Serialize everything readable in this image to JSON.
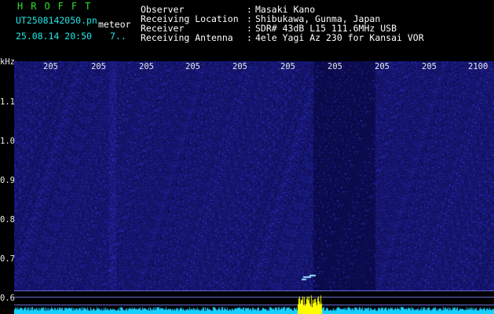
{
  "header": {
    "app_title": "HROFFT",
    "filename": "UT2508142050.pn",
    "mode": "meteor",
    "datetime": "25.08.14 20:50",
    "counter": "7..",
    "fields": [
      {
        "label": "Observer",
        "sep": ":",
        "value": "Masaki Kano"
      },
      {
        "label": "Receiving Location",
        "sep": ":",
        "value": "Shibukawa, Gunma, Japan"
      },
      {
        "label": "Receiver",
        "sep": ":",
        "value": "SDR# 43dB L15 111.6MHz USB"
      },
      {
        "label": "Receiving Antenna",
        "sep": ":",
        "value": "4ele Yagi Az 230 for Kansai VOR"
      }
    ]
  },
  "spectrogram": {
    "y_unit": "kHz",
    "y_ticks": [
      "1.1",
      "1.0",
      "0.9",
      "0.8",
      "0.7",
      "0.6"
    ],
    "x_ticks": [
      "205",
      "205",
      "205",
      "205",
      "205",
      "205",
      "205",
      "205",
      "205",
      "2100"
    ],
    "colors": {
      "background": "#000033",
      "noise": "#3a3ad0",
      "signal": "#ffff00",
      "trace": "#18d0ff"
    }
  }
}
